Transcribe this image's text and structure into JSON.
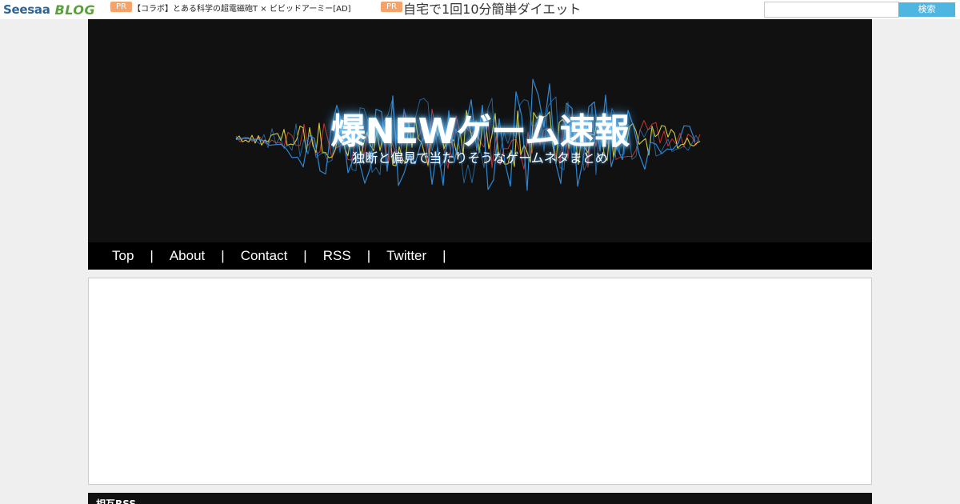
{
  "topbar": {
    "logo_seesaa": "Seesaa",
    "logo_blog": "BLOG",
    "ad1": {
      "badge": "PR",
      "text": "【コラボ】とある科学の超電磁砲T × ビビッドアーミー[AD]"
    },
    "ad2": {
      "badge": "PR",
      "text": "自宅で1回10分簡単ダイエット"
    },
    "search": {
      "value": "",
      "placeholder": "",
      "button_label": "検索"
    }
  },
  "header": {
    "title": "爆NEWゲーム速報",
    "description": "独断と偏見で当たりそうなゲームネタまとめ",
    "colors": {
      "background": "#111111",
      "wave_blue": "#2f8fe0",
      "wave_yellow": "#e8e23a",
      "wave_red": "#e23a3a",
      "glow": "#4aa8ff"
    }
  },
  "nav": {
    "items": [
      "Top",
      "About",
      "Contact",
      "RSS",
      "Twitter"
    ],
    "separator": "|"
  },
  "sidebar_section": {
    "title": "相互RSS"
  }
}
